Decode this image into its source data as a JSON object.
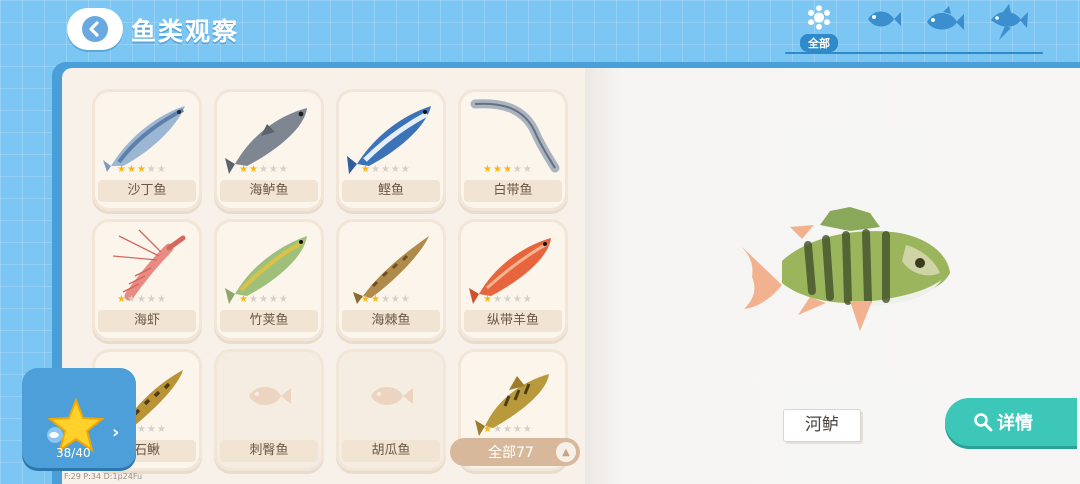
{
  "header": {
    "title": "鱼类观察",
    "filters": [
      {
        "icon": "all-dots-icon",
        "label": "全部",
        "active": true
      },
      {
        "icon": "small-fish-icon",
        "label": ""
      },
      {
        "icon": "medium-fish-icon",
        "label": ""
      },
      {
        "icon": "large-fish-icon",
        "label": ""
      }
    ]
  },
  "fish_list": [
    {
      "name": "沙丁鱼",
      "stars": 3,
      "max_stars": 5,
      "locked": false
    },
    {
      "name": "海鲈鱼",
      "stars": 2,
      "max_stars": 5,
      "locked": false
    },
    {
      "name": "鲣鱼",
      "stars": 1,
      "max_stars": 5,
      "locked": false
    },
    {
      "name": "白带鱼",
      "stars": 3,
      "max_stars": 5,
      "locked": false
    },
    {
      "name": "海虾",
      "stars": 1,
      "max_stars": 5,
      "locked": false
    },
    {
      "name": "竹荚鱼",
      "stars": 1,
      "max_stars": 5,
      "locked": false
    },
    {
      "name": "海棘鱼",
      "stars": 2,
      "max_stars": 5,
      "locked": false
    },
    {
      "name": "纵带羊鱼",
      "stars": 1,
      "max_stars": 5,
      "locked": false
    },
    {
      "name": "石鳅",
      "stars": 1,
      "max_stars": 5,
      "locked": false
    },
    {
      "name": "刺臀鱼",
      "stars": 0,
      "max_stars": 5,
      "locked": true
    },
    {
      "name": "胡瓜鱼",
      "stars": 0,
      "max_stars": 5,
      "locked": true
    },
    {
      "name": "",
      "stars": 1,
      "max_stars": 5,
      "locked": false
    }
  ],
  "filter_dropdown": {
    "label": "全部77"
  },
  "collection": {
    "count": "38/40"
  },
  "detail": {
    "fish_name": "河鲈",
    "details_button": "详情"
  },
  "footer": {
    "debug_text": "F:29  P:34  D:1p24Fu"
  },
  "colors": {
    "accent_blue": "#2e8ac8",
    "teal_button": "#3cc7b8",
    "star_gold": "#f6b71b"
  }
}
